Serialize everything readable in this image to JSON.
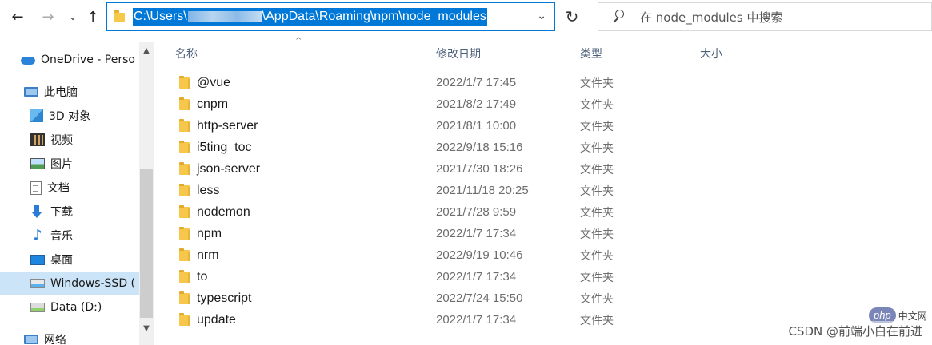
{
  "toolbar": {
    "back_glyph": "←",
    "forward_glyph": "→",
    "recent_glyph": "⌄",
    "up_glyph": "↑",
    "refresh_glyph": "↻"
  },
  "address": {
    "path_prefix": "C:\\Users\\",
    "path_suffix": "\\AppData\\Roaming\\npm\\node_modules",
    "dropdown_glyph": "⌄"
  },
  "search": {
    "placeholder": "在 node_modules 中搜索"
  },
  "sidebar": {
    "items": [
      {
        "label": "OneDrive - Perso",
        "icon": "onedrive-cloud-icon"
      },
      {
        "label": "此电脑",
        "icon": "this-pc-icon"
      },
      {
        "label": "3D 对象",
        "icon": "3d-objects-icon"
      },
      {
        "label": "视频",
        "icon": "videos-icon"
      },
      {
        "label": "图片",
        "icon": "pictures-icon"
      },
      {
        "label": "文档",
        "icon": "documents-icon"
      },
      {
        "label": "下载",
        "icon": "downloads-icon"
      },
      {
        "label": "音乐",
        "icon": "music-icon"
      },
      {
        "label": "桌面",
        "icon": "desktop-icon"
      },
      {
        "label": "Windows-SSD (",
        "icon": "windows-drive-icon"
      },
      {
        "label": "Data (D:)",
        "icon": "data-drive-icon"
      },
      {
        "label": "网络",
        "icon": "network-icon"
      }
    ]
  },
  "columns": {
    "name": "名称",
    "modified": "修改日期",
    "type": "类型",
    "size": "大小"
  },
  "files": [
    {
      "name": "@vue",
      "modified": "2022/1/7 17:45",
      "type": "文件夹"
    },
    {
      "name": "cnpm",
      "modified": "2021/8/2 17:49",
      "type": "文件夹"
    },
    {
      "name": "http-server",
      "modified": "2021/8/1 10:00",
      "type": "文件夹"
    },
    {
      "name": "i5ting_toc",
      "modified": "2022/9/18 15:16",
      "type": "文件夹"
    },
    {
      "name": "json-server",
      "modified": "2021/7/30 18:26",
      "type": "文件夹"
    },
    {
      "name": "less",
      "modified": "2021/11/18 20:25",
      "type": "文件夹"
    },
    {
      "name": "nodemon",
      "modified": "2021/7/28 9:59",
      "type": "文件夹"
    },
    {
      "name": "npm",
      "modified": "2022/1/7 17:34",
      "type": "文件夹"
    },
    {
      "name": "nrm",
      "modified": "2022/9/19 10:46",
      "type": "文件夹"
    },
    {
      "name": "to",
      "modified": "2022/1/7 17:34",
      "type": "文件夹"
    },
    {
      "name": "typescript",
      "modified": "2022/7/24 15:50",
      "type": "文件夹"
    },
    {
      "name": "update",
      "modified": "2022/1/7 17:34",
      "type": "文件夹"
    }
  ],
  "watermark": {
    "text": "CSDN @前端小白在前进",
    "php_logo": "php",
    "php_cn": "中文网"
  },
  "colors": {
    "selection": "#0078d7",
    "sidebar_selected": "#cce4f7",
    "folder": "#f6c74a"
  }
}
